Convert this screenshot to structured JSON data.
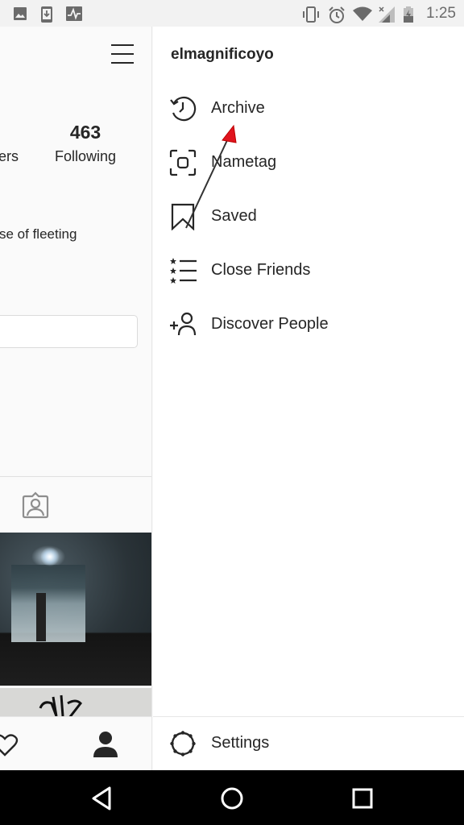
{
  "status_bar": {
    "left_icons": [
      "image-icon",
      "download-icon",
      "activity-icon"
    ],
    "right_icons": [
      "vibrate-icon",
      "alarm-icon",
      "wifi-icon",
      "signal-icon",
      "battery-charging-icon"
    ],
    "time": "1:25"
  },
  "profile": {
    "followers_label_partial": "ers",
    "following_count": "463",
    "following_label": "Following",
    "bio_partial": "se of fleeting"
  },
  "drawer": {
    "username": "elmagnificoyo",
    "items": [
      {
        "label": "Archive",
        "icon": "archive-history-icon"
      },
      {
        "label": "Nametag",
        "icon": "nametag-scan-icon"
      },
      {
        "label": "Saved",
        "icon": "bookmark-icon"
      },
      {
        "label": "Close Friends",
        "icon": "close-friends-list-icon"
      },
      {
        "label": "Discover People",
        "icon": "add-person-icon"
      }
    ],
    "footer": {
      "label": "Settings",
      "icon": "settings-gear-icon"
    }
  },
  "annotation": {
    "type": "arrow",
    "color": "#e0141e",
    "points_to": "Archive"
  },
  "colors": {
    "text": "#262626",
    "panel_bg": "#fafafa",
    "drawer_bg": "#ffffff",
    "divider": "#e6e6e6",
    "nav_bar": "#000000"
  }
}
